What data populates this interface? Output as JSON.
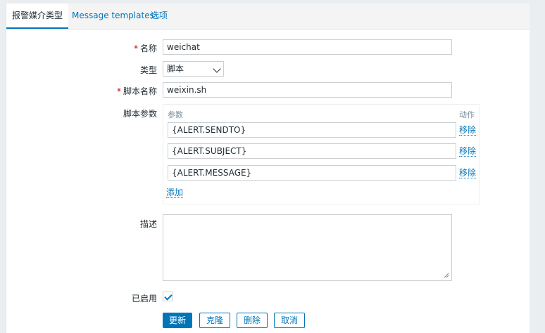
{
  "tabs": [
    {
      "label": "报警媒介类型"
    },
    {
      "label": "Message templates"
    },
    {
      "label": "选项"
    }
  ],
  "form": {
    "name": {
      "label": "名称",
      "value": "weichat"
    },
    "type": {
      "label": "类型",
      "value": "脚本"
    },
    "script_name": {
      "label": "脚本名称",
      "value": "weixin.sh"
    },
    "script_params": {
      "label": "脚本参数",
      "col_param": "参数",
      "col_action": "动作",
      "rows": [
        {
          "value": "{ALERT.SENDTO}",
          "action": "移除"
        },
        {
          "value": "{ALERT.SUBJECT}",
          "action": "移除"
        },
        {
          "value": "{ALERT.MESSAGE}",
          "action": "移除"
        }
      ],
      "add_label": "添加"
    },
    "description": {
      "label": "描述",
      "value": ""
    },
    "enabled": {
      "label": "已启用",
      "checked": true
    }
  },
  "buttons": {
    "update": "更新",
    "clone": "克隆",
    "delete": "删除",
    "cancel": "取消"
  },
  "required_mark": "*",
  "colors": {
    "accent": "#0275b8",
    "required": "#d40000",
    "background": "#ebeef0"
  }
}
